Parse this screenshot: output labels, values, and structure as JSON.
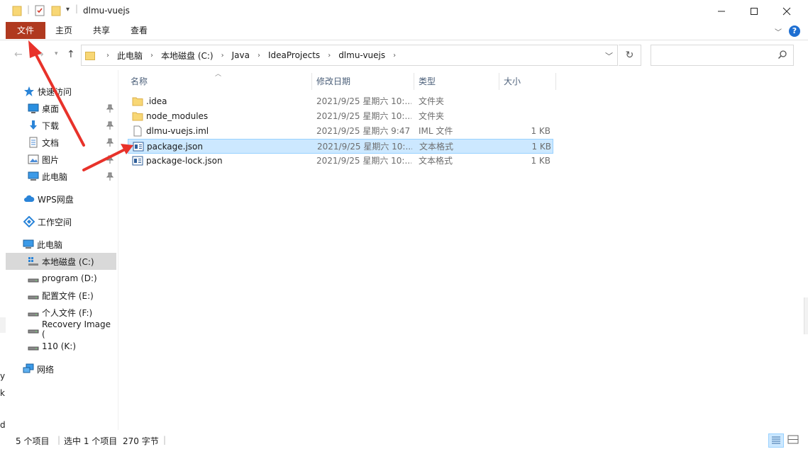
{
  "window": {
    "title": "dlmu-vuejs",
    "controls": {
      "minimize": "—",
      "maximize": "☐",
      "close": "✕"
    }
  },
  "ribbon": {
    "tabs": [
      "文件",
      "主页",
      "共享",
      "查看"
    ],
    "help": "?"
  },
  "address": {
    "crumbs": [
      "此电脑",
      "本地磁盘 (C:)",
      "Java",
      "IdeaProjects",
      "dlmu-vuejs"
    ],
    "search_placeholder": ""
  },
  "sidebar": {
    "items": [
      {
        "label": "快速访问",
        "icon": "star-icon",
        "pinned": false
      },
      {
        "label": "桌面",
        "icon": "desktop-icon",
        "pinned": true
      },
      {
        "label": "下载",
        "icon": "download-icon",
        "pinned": true
      },
      {
        "label": "文档",
        "icon": "document-icon",
        "pinned": true
      },
      {
        "label": "图片",
        "icon": "picture-icon",
        "pinned": true
      },
      {
        "label": "此电脑",
        "icon": "computer-icon",
        "pinned": true
      },
      {
        "label": "WPS网盘",
        "icon": "cloud-icon",
        "pinned": false
      },
      {
        "label": "工作空间",
        "icon": "workspace-icon",
        "pinned": false
      },
      {
        "label": "此电脑",
        "icon": "computer-icon",
        "pinned": false
      },
      {
        "label": "本地磁盘 (C:)",
        "icon": "system-drive-icon",
        "pinned": false,
        "selected": true
      },
      {
        "label": "program (D:)",
        "icon": "drive-icon",
        "pinned": false
      },
      {
        "label": "配置文件 (E:)",
        "icon": "drive-icon",
        "pinned": false
      },
      {
        "label": "个人文件 (F:)",
        "icon": "drive-icon",
        "pinned": false
      },
      {
        "label": "Recovery Image (",
        "icon": "drive-icon",
        "pinned": false
      },
      {
        "label": "110 (K:)",
        "icon": "drive-icon",
        "pinned": false
      },
      {
        "label": "网络",
        "icon": "network-icon",
        "pinned": false
      }
    ]
  },
  "columns": [
    "名称",
    "修改日期",
    "类型",
    "大小"
  ],
  "files": [
    {
      "name": ".idea",
      "date": "2021/9/25 星期六 10:...",
      "type": "文件夹",
      "size": "",
      "icon": "folder-icon"
    },
    {
      "name": "node_modules",
      "date": "2021/9/25 星期六 10:...",
      "type": "文件夹",
      "size": "",
      "icon": "folder-icon"
    },
    {
      "name": "dlmu-vuejs.iml",
      "date": "2021/9/25 星期六 9:47",
      "type": "IML 文件",
      "size": "1 KB",
      "icon": "file-icon"
    },
    {
      "name": "package.json",
      "date": "2021/9/25 星期六 10:...",
      "type": "文本格式",
      "size": "1 KB",
      "icon": "text-file-icon",
      "selected": true
    },
    {
      "name": "package-lock.json",
      "date": "2021/9/25 星期六 10:...",
      "type": "文本格式",
      "size": "1 KB",
      "icon": "text-file-icon"
    }
  ],
  "status": {
    "count": "5 个项目",
    "selected": "选中 1 个项目",
    "size": "270 字节"
  },
  "background_fragments": [
    "y",
    "k",
    "d"
  ],
  "colors": {
    "file_tab": "#b0391f",
    "selection": "#cce8ff",
    "selection_border": "#99d1ff",
    "annotation_arrow": "#e8322a"
  }
}
